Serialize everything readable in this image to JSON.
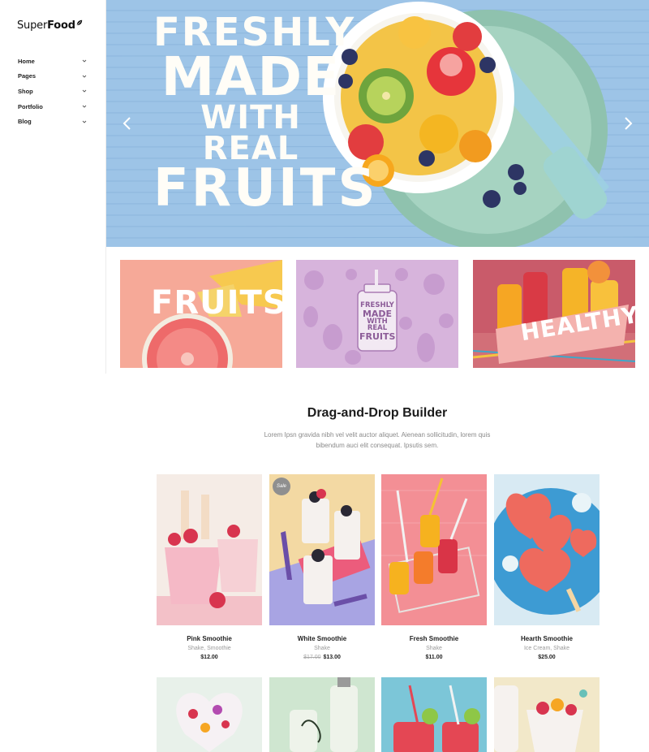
{
  "brand": {
    "name_light": "Super",
    "name_bold": "Food"
  },
  "nav": {
    "items": [
      {
        "label": "Home"
      },
      {
        "label": "Pages"
      },
      {
        "label": "Shop"
      },
      {
        "label": "Portfolio"
      },
      {
        "label": "Blog"
      }
    ]
  },
  "hero": {
    "lines": [
      "FRESHLY",
      "MADE",
      "WITH REAL",
      "FRUITS"
    ]
  },
  "banners": [
    {
      "label": "FRUITS"
    },
    {
      "label_lines": [
        "FRESHLY",
        "MADE",
        "WITH REAL",
        "FRUITS"
      ]
    },
    {
      "label": "HEALTHY"
    }
  ],
  "section": {
    "title": "Drag-and-Drop Builder",
    "description": "Lorem Ipsn gravida nibh vel velit auctor aliquet. Aienean sollicitudin, lorem quis bibendum auci elit consequat. Ipsutis sem."
  },
  "products": [
    {
      "name": "Pink Smoothie",
      "categories": "Shake, Smoothie",
      "price": "$12.00"
    },
    {
      "name": "White Smoothie",
      "categories": "Shake",
      "old_price": "$17.00",
      "price": "$13.00",
      "badge": "Sale"
    },
    {
      "name": "Fresh Smoothie",
      "categories": "Shake",
      "price": "$11.00"
    },
    {
      "name": "Hearth Smoothie",
      "categories": "Ice Cream, Shake",
      "price": "$25.00"
    }
  ],
  "colors": {
    "hero_bg": "#9cc3e6",
    "accent": "#f6a998",
    "text": "#222222"
  }
}
